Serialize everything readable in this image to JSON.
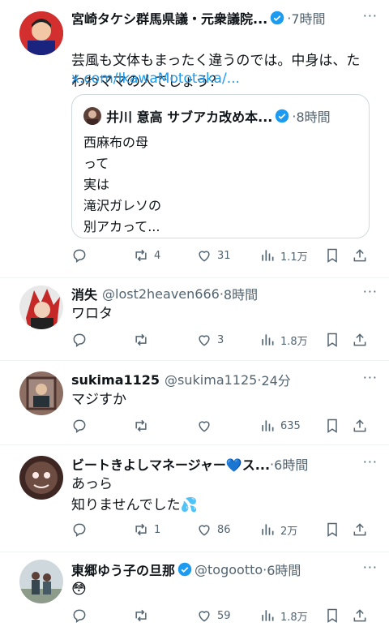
{
  "tweets": [
    {
      "name": "宮崎タケシ群馬県議・元衆議院...",
      "handle": "",
      "time": "7時間",
      "text": "芸風も文体もまったく違うのでは。中身は、た\nわわママの人でしょう？",
      "link": "x.com/IkawaMototaka/...",
      "quote": {
        "name": "井川 意高 サブアカ改め本...",
        "time": "8時間",
        "text": "西麻布の母\nって\n実は\n滝沢ガレソの\n別アカって..."
      },
      "counts": {
        "reply": "",
        "retweet": "4",
        "like": "31",
        "views": "1.1万"
      }
    },
    {
      "name": "消失",
      "handle": "@lost2heaven666",
      "time": "8時間",
      "text": "ワロタ",
      "counts": {
        "reply": "",
        "retweet": "",
        "like": "3",
        "views": "1.8万"
      }
    },
    {
      "name": "sukima1125",
      "handle": "@sukima1125",
      "time": "24分",
      "text": "マジすか",
      "counts": {
        "reply": "",
        "retweet": "",
        "like": "",
        "views": "635"
      }
    },
    {
      "name": "ビートきよしマネージャー💙ス...",
      "handle": "",
      "time": "6時間",
      "text": "あっら\n知りませんでした💦",
      "counts": {
        "reply": "",
        "retweet": "1",
        "like": "86",
        "views": "2万"
      }
    },
    {
      "name": "東郷ゆう子の旦那",
      "handle": "@togootto",
      "time": "6時間",
      "text": "😳",
      "counts": {
        "reply": "",
        "retweet": "",
        "like": "59",
        "views": "1.8万"
      }
    }
  ],
  "separator": "·",
  "more_icon": "more-icon",
  "colors": {
    "accent": "#1d9bf0",
    "muted": "#536471",
    "verified": "#1d9bf0"
  }
}
